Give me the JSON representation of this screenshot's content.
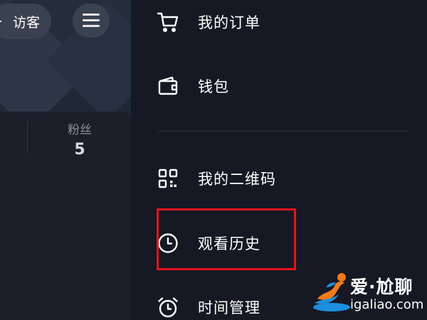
{
  "header": {
    "visitor_label": "访客"
  },
  "stats": {
    "fans_label": "粉丝",
    "fans_count": "5"
  },
  "drawer": {
    "items": [
      {
        "label": "我的订单",
        "icon": "cart-icon"
      },
      {
        "label": "钱包",
        "icon": "wallet-icon"
      },
      {
        "label": "我的二维码",
        "icon": "qr-code-icon"
      },
      {
        "label": "观看历史",
        "icon": "clock-icon",
        "highlighted": true
      },
      {
        "label": "时间管理",
        "icon": "alarm-icon"
      }
    ]
  },
  "watermark": {
    "title": "爱·尬聊",
    "url": "igaliao.com"
  },
  "colors": {
    "background": "#161823",
    "highlight_border": "#e2141d",
    "text": "#ffffff",
    "muted_text": "#8c8f99"
  }
}
